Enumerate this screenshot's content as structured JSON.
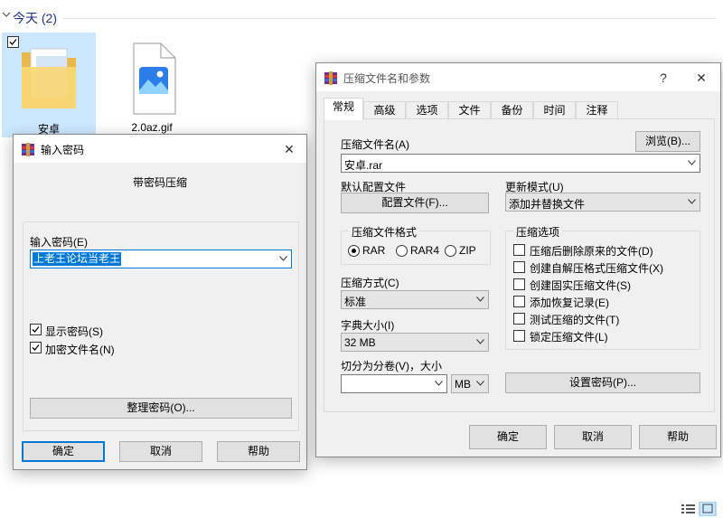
{
  "explorer": {
    "group_title": "今天 (2)",
    "files": [
      {
        "name": "安卓",
        "type": "folder-icon",
        "selected": true
      },
      {
        "name": "2.0az.gif",
        "type": "image-file-icon",
        "selected": false
      }
    ]
  },
  "password_dialog": {
    "title": "输入密码",
    "heading": "带密码压缩",
    "password_label": "输入密码(E)",
    "password_value": "上老王论坛当老王",
    "show_password": {
      "label": "显示密码(S)",
      "checked": true
    },
    "encrypt_names": {
      "label": "加密文件名(N)",
      "checked": true
    },
    "organize_button": "整理密码(O)...",
    "ok_button": "确定",
    "cancel_button": "取消",
    "help_button": "帮助",
    "close_glyph": "✕"
  },
  "archive_dialog": {
    "title": "压缩文件名和参数",
    "help_glyph": "?",
    "close_glyph": "✕",
    "tabs": [
      "常规",
      "高级",
      "选项",
      "文件",
      "备份",
      "时间",
      "注释"
    ],
    "archive_name_label": "压缩文件名(A)",
    "browse_button": "浏览(B)...",
    "archive_name_value": "安卓.rar",
    "default_profile_label": "默认配置文件",
    "profile_button": "配置文件(F)...",
    "update_mode_label": "更新模式(U)",
    "update_mode_value": "添加并替换文件",
    "format_group_title": "压缩文件格式",
    "formats": [
      {
        "label": "RAR",
        "selected": true
      },
      {
        "label": "RAR4",
        "selected": false
      },
      {
        "label": "ZIP",
        "selected": false
      }
    ],
    "method_label": "压缩方式(C)",
    "method_value": "标准",
    "dict_label": "字典大小(I)",
    "dict_value": "32 MB",
    "split_label": "切分为分卷(V)，大小",
    "split_unit": "MB",
    "options_group_title": "压缩选项",
    "options": [
      {
        "label": "压缩后删除原来的文件(D)",
        "checked": false
      },
      {
        "label": "创建自解压格式压缩文件(X)",
        "checked": false
      },
      {
        "label": "创建固实压缩文件(S)",
        "checked": false
      },
      {
        "label": "添加恢复记录(E)",
        "checked": false
      },
      {
        "label": "测试压缩的文件(T)",
        "checked": false
      },
      {
        "label": "锁定压缩文件(L)",
        "checked": false
      }
    ],
    "set_password_button": "设置密码(P)...",
    "ok_button": "确定",
    "cancel_button": "取消",
    "help_button": "帮助"
  },
  "colors": {
    "accent": "#0078d7",
    "selection_bg": "#cce8ff",
    "dialog_bg": "#f0f0f0",
    "group_title": "#1e3287"
  }
}
